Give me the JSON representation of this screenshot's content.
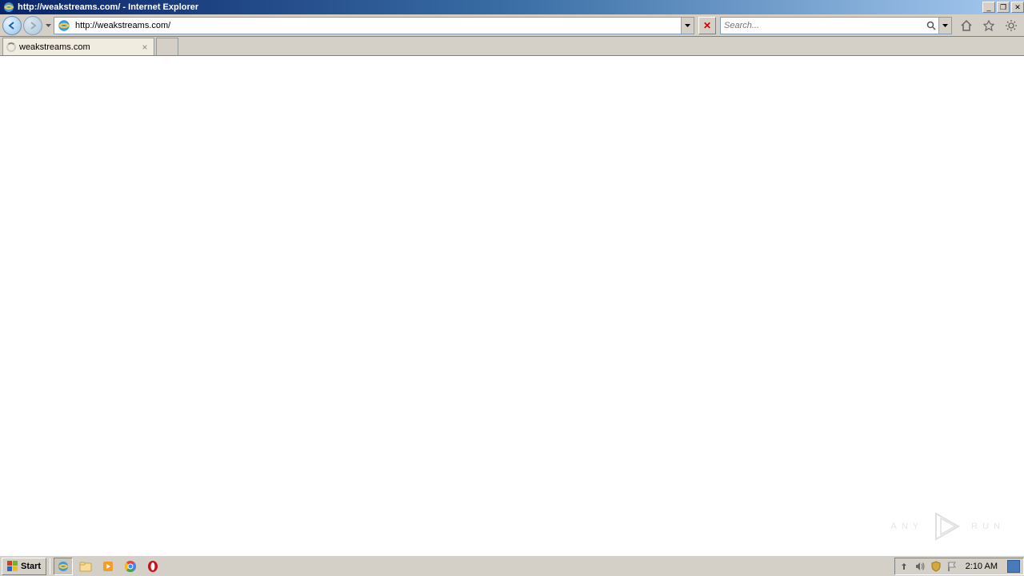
{
  "titlebar": {
    "url": "http://weakstreams.com/",
    "app": "Internet Explorer"
  },
  "navbar": {
    "address": "http://weakstreams.com/",
    "search_placeholder": "Search...",
    "stop": "✕"
  },
  "tab": {
    "title": "weakstreams.com"
  },
  "watermark": {
    "left": "ANY",
    "right": "RUN"
  },
  "taskbar": {
    "start": "Start",
    "clock": "2:10 AM"
  }
}
